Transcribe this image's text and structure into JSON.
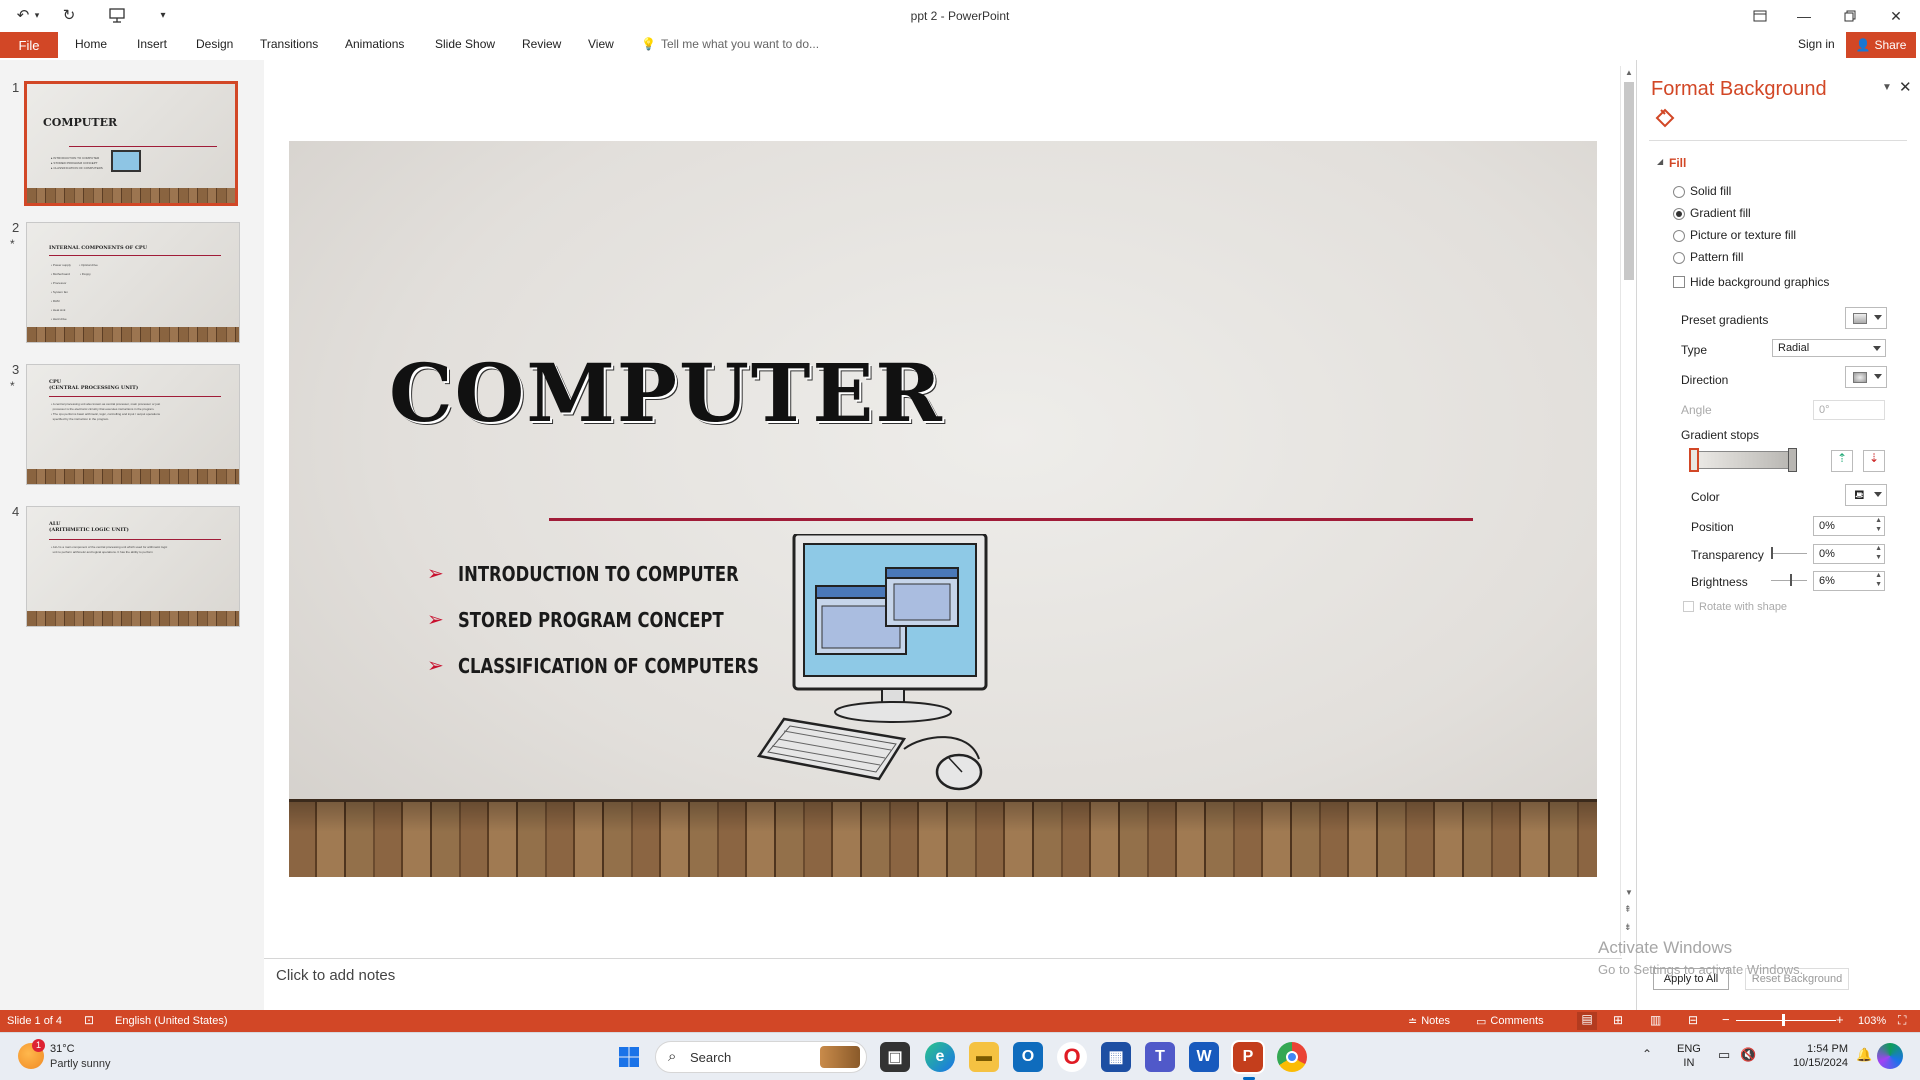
{
  "window": {
    "title": "ppt 2 - PowerPoint"
  },
  "quick_access": {
    "icons": [
      "undo-icon",
      "redo-icon",
      "present-icon",
      "customize-icon"
    ]
  },
  "menu": {
    "file": "File",
    "tabs": [
      "Home",
      "Insert",
      "Design",
      "Transitions",
      "Animations",
      "Slide Show",
      "Review",
      "View"
    ],
    "tell_me": "Tell me what you want to do...",
    "sign_in": "Sign in",
    "share": "Share"
  },
  "thumbnails": [
    {
      "number": "1",
      "star": "",
      "title": "COMPUTER",
      "lines": "▸ INTRODUCTION TO COMPUTER\n▸ STORED PROGRAM CONCEPT\n▸ CLASSIFICATION OF COMPUTERS",
      "selected": true
    },
    {
      "number": "2",
      "star": "*",
      "title": "INTERNAL COMPONENTS OF CPU",
      "lines": "• Power supply          • Optical drive\n• Motherboard            • Floppy\n• Processor\n• System fan\n• RAM\n• Heat sink\n• Hard drive",
      "selected": false
    },
    {
      "number": "3",
      "star": "*",
      "title": "CPU\n(CENTRAL PROCESSING UNIT)",
      "lines": "• A central processing unit also known as central processor, main processor or just\n  processor is the electronic circuitry that executes instructions in the program.\n• The cpu performs basic arithmetic, logic, controlling and input / output operations\n  specified by the instruction in the program.",
      "selected": false
    },
    {
      "number": "4",
      "star": "",
      "title": "ALU\n(ARITHMETIC LOGIC UNIT)",
      "lines": "• ALU is a main component of the central processing unit which used for arithmetic logic\n  unit to perform arithmetic and logical operations. It has the ability to perform",
      "selected": false
    }
  ],
  "slide": {
    "title": "COMPUTER",
    "bullets": [
      "INTRODUCTION TO COMPUTER",
      "STORED PROGRAM CONCEPT",
      "CLASSIFICATION OF COMPUTERS"
    ]
  },
  "notes": {
    "placeholder": "Click to add notes"
  },
  "format_panel": {
    "title": "Format Background",
    "section": "Fill",
    "options": [
      {
        "label": "Solid fill",
        "checked": false
      },
      {
        "label": "Gradient fill",
        "checked": true
      },
      {
        "label": "Picture or texture fill",
        "checked": false
      },
      {
        "label": "Pattern fill",
        "checked": false
      }
    ],
    "hide_graphics": "Hide background graphics",
    "preset_gradients": "Preset gradients",
    "type_label": "Type",
    "type_value": "Radial",
    "direction": "Direction",
    "angle_label": "Angle",
    "angle_value": "0°",
    "gradient_stops": "Gradient stops",
    "color": "Color",
    "position_label": "Position",
    "position_value": "0%",
    "transparency_label": "Transparency",
    "transparency_value": "0%",
    "brightness_label": "Brightness",
    "brightness_value": "6%",
    "rotate_with_shape": "Rotate with shape",
    "apply_all": "Apply to All",
    "reset": "Reset Background"
  },
  "watermark": {
    "line1": "Activate Windows",
    "line2": "Go to Settings to activate Windows."
  },
  "status": {
    "slide_of": "Slide 1 of 4",
    "language": "English (United States)",
    "notes": "Notes",
    "comments": "Comments",
    "zoom": "103%"
  },
  "taskbar": {
    "weather_temp": "31°C",
    "weather_desc": "Partly sunny",
    "weather_badge": "1",
    "search": "Search",
    "lang1": "ENG",
    "lang2": "IN",
    "time": "1:54 PM",
    "date": "10/15/2024"
  },
  "colors": {
    "accent": "#d24726",
    "slide_rule": "#a01c38",
    "bullet_arrow": "#c8102e"
  }
}
